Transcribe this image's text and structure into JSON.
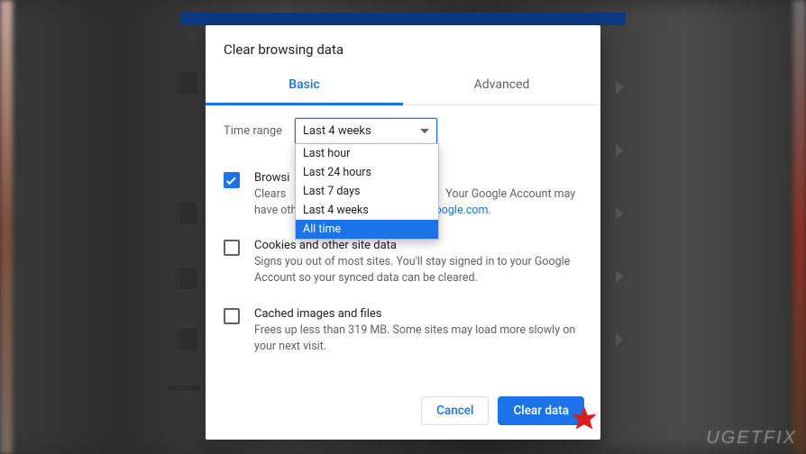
{
  "dialog": {
    "title": "Clear browsing data",
    "tabs": {
      "basic": "Basic",
      "advanced": "Advanced",
      "active": "basic"
    },
    "time_range": {
      "label": "Time range",
      "selected": "Last 4 weeks",
      "options": [
        "Last hour",
        "Last 24 hours",
        "Last 7 days",
        "Last 4 weeks",
        "All time"
      ],
      "highlighted": "All time"
    },
    "options": [
      {
        "title": "Browsi",
        "desc_full": "Clears history and autocompletions in the address bar. Your Google Account may have other forms of browsing history at myactivity.google.com.",
        "desc_visible_prefix": "Clears ",
        "desc_visible_suffix": "Your Google Account may have other fo",
        "desc_link_fragment": "vity.google.com.",
        "checked": true
      },
      {
        "title": "Cookies and other site data",
        "desc": "Signs you out of most sites. You'll stay signed in to your Google Account so your synced data can be cleared.",
        "checked": false
      },
      {
        "title": "Cached images and files",
        "desc": "Frees up less than 319 MB. Some sites may load more slowly on your next visit.",
        "checked": false
      }
    ],
    "actions": {
      "cancel": "Cancel",
      "confirm": "Clear data"
    }
  },
  "watermark": "UGETFIX"
}
